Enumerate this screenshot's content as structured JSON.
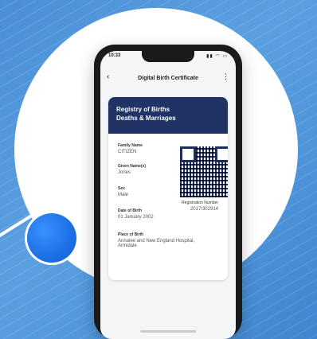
{
  "status": {
    "time": "10:33",
    "indicators": "▮▮ ◠ ▭"
  },
  "app": {
    "title": "Digital Birth Certificate"
  },
  "certificate": {
    "header": [
      "Registry of Births",
      "Deaths & Marriages"
    ],
    "fields": [
      {
        "label": "Family Name",
        "value": "CITIZEN"
      },
      {
        "label": "Given Name(s)",
        "value": "Jones"
      },
      {
        "label": "Sex",
        "value": "Male"
      },
      {
        "label": "Date of Birth",
        "value": "01 January 2002"
      },
      {
        "label": "Place of Birth",
        "value": "Annalee and New England Hospital, Armidale"
      }
    ],
    "registration": {
      "label": "Registration Number",
      "value": "2017/302914"
    }
  }
}
